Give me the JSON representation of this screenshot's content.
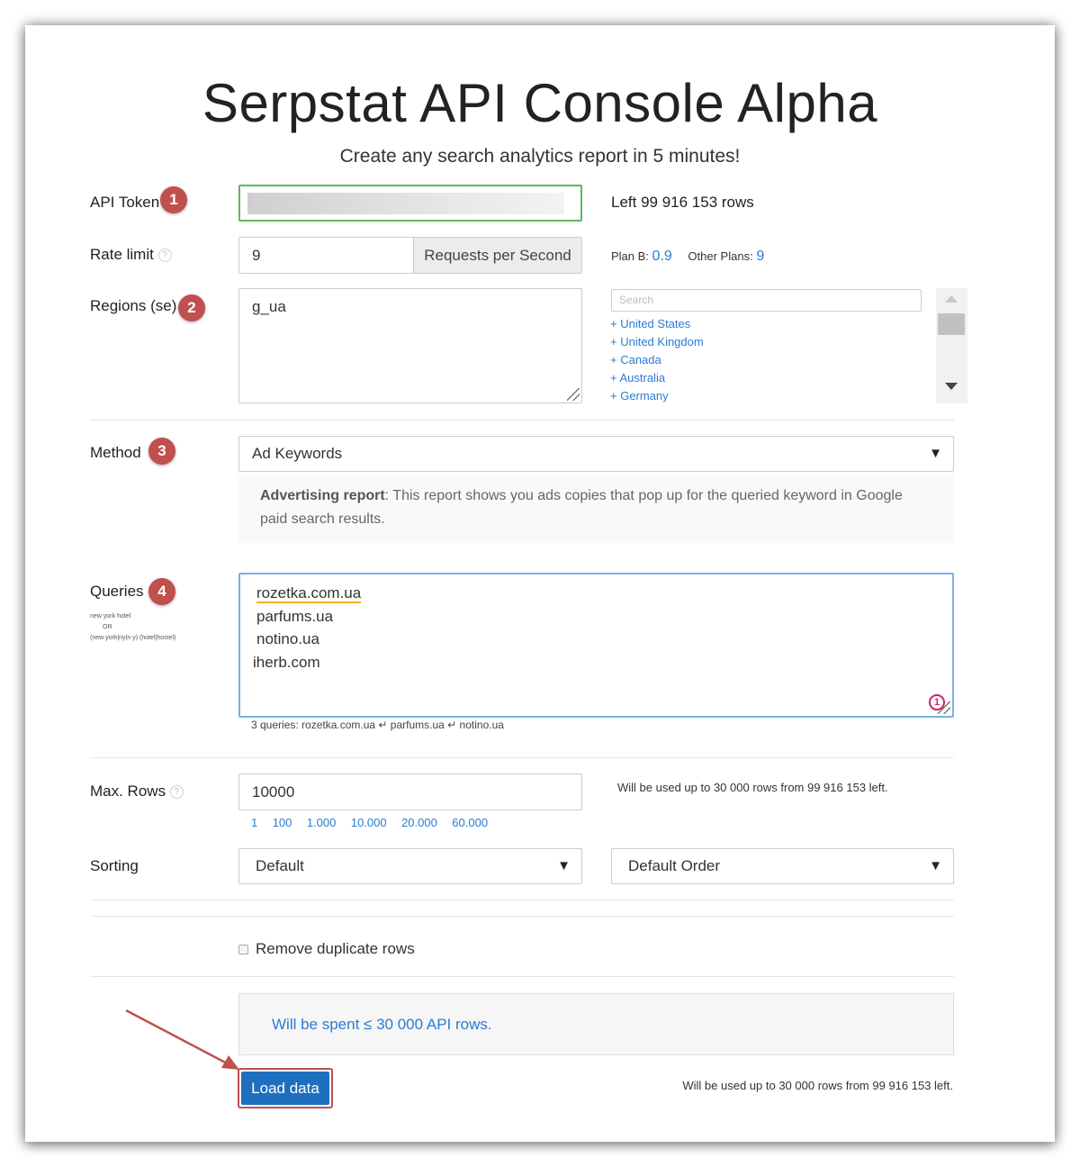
{
  "header": {
    "title": "Serpstat API Console Alpha",
    "subtitle": "Create any search analytics report in 5 minutes!"
  },
  "api_token": {
    "label": "API Token",
    "badge": "1",
    "value": "",
    "rows_left": "Left 99 916 153 rows"
  },
  "rate_limit": {
    "label": "Rate limit",
    "help": "?",
    "value": "9",
    "unit": "Requests per Second",
    "plan_b_label": "Plan B:",
    "plan_b_value": "0.9",
    "other_plans_label": "Other Plans:",
    "other_plans_value": "9"
  },
  "regions": {
    "label": "Regions (se)",
    "badge": "2",
    "value": "g_ua",
    "search_placeholder": "Search",
    "options": [
      "+ United States",
      "+ United Kingdom",
      "+ Canada",
      "+ Australia",
      "+ Germany"
    ]
  },
  "method": {
    "label": "Method",
    "badge": "3",
    "selected": "Ad Keywords",
    "arrow": "▼",
    "description_bold": "Advertising report",
    "description_text": ": This report shows you ads copies that pop up for the queried keyword in Google paid search results."
  },
  "queries": {
    "label": "Queries",
    "badge": "4",
    "hint_line1": "new york hotel",
    "hint_line2": "OR",
    "hint_line3": "(new york|ny|n y) (hotel|hostel)",
    "lines": [
      "rozetka.com.ua",
      "parfums.ua",
      "notino.ua",
      "iherb.com"
    ],
    "counter_badge": "1",
    "summary": "3 queries: rozetka.com.ua ↵ parfums.ua ↵ notino.ua"
  },
  "max_rows": {
    "label": "Max. Rows",
    "help": "?",
    "value": "10000",
    "presets": [
      "1",
      "100",
      "1.000",
      "10.000",
      "20.000",
      "60.000"
    ],
    "note": "Will be used up to 30 000 rows from 99 916 153 left."
  },
  "sorting": {
    "label": "Sorting",
    "field": "Default",
    "order": "Default Order",
    "arrow": "▼"
  },
  "options": {
    "remove_duplicates_label": "Remove duplicate rows",
    "remove_duplicates_checked": false
  },
  "summary": {
    "spend_text": "Will be spent ≤ 30 000 API rows."
  },
  "footer": {
    "load_button": "Load data",
    "note": "Will be used up to 30 000 rows from 99 916 153 left."
  },
  "colors": {
    "accent": "#2a7bd4",
    "badge": "#c0504d",
    "button": "#1f6fbf",
    "token_border": "#5cb85c",
    "focus_border": "#7aaee8",
    "arrow": "#c0504d"
  }
}
